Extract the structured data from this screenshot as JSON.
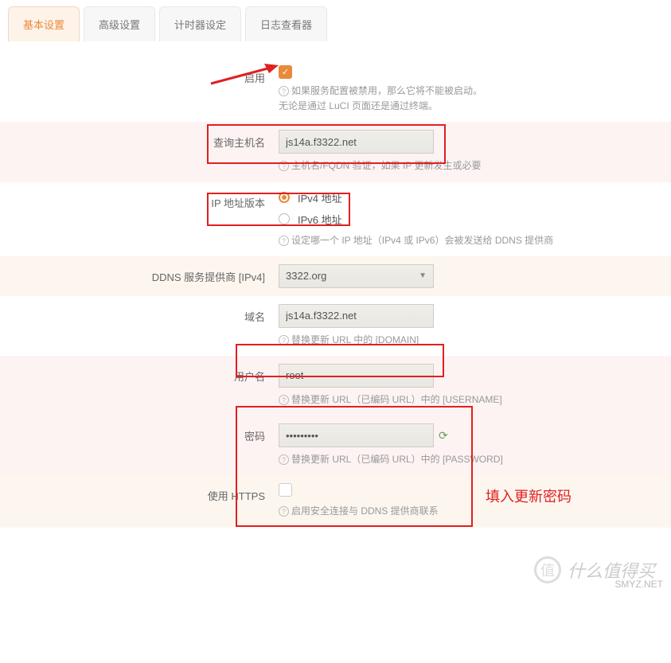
{
  "tabs": {
    "t0": "基本设置",
    "t1": "高级设置",
    "t2": "计时器设定",
    "t3": "日志查看器"
  },
  "rows": {
    "enable": {
      "label": "启用",
      "hint1": "如果服务配置被禁用，那么它将不能被启动。",
      "hint2": "无论是通过 LuCI 页面还是通过终端。"
    },
    "hostname": {
      "label": "查询主机名",
      "value": "js14a.f3322.net",
      "hint": "主机名/FQDN 验证，如果 IP 更新发生或必要"
    },
    "ipver": {
      "label": "IP 地址版本",
      "opt1": "IPv4 地址",
      "opt2": "IPv6 地址",
      "hint": "设定哪一个 IP 地址（IPv4 或 IPv6）会被发送给 DDNS 提供商"
    },
    "provider": {
      "label": "DDNS 服务提供商 [IPv4]",
      "value": "3322.org"
    },
    "domain": {
      "label": "域名",
      "value": "js14a.f3322.net",
      "hint": "替换更新 URL 中的 [DOMAIN]"
    },
    "username": {
      "label": "用户名",
      "value": "root",
      "hint": "替换更新 URL（已编码 URL）中的 [USERNAME]"
    },
    "password": {
      "label": "密码",
      "value": "•••••••••",
      "hint": "替换更新 URL（已编码 URL）中的 [PASSWORD]"
    },
    "https": {
      "label": "使用 HTTPS",
      "hint": "启用安全连接与 DDNS 提供商联系"
    }
  },
  "annotations": {
    "fill_password": "填入更新密码"
  },
  "watermark": {
    "text": "什么值得买",
    "site": "SMYZ.NET",
    "glyph": "值"
  }
}
